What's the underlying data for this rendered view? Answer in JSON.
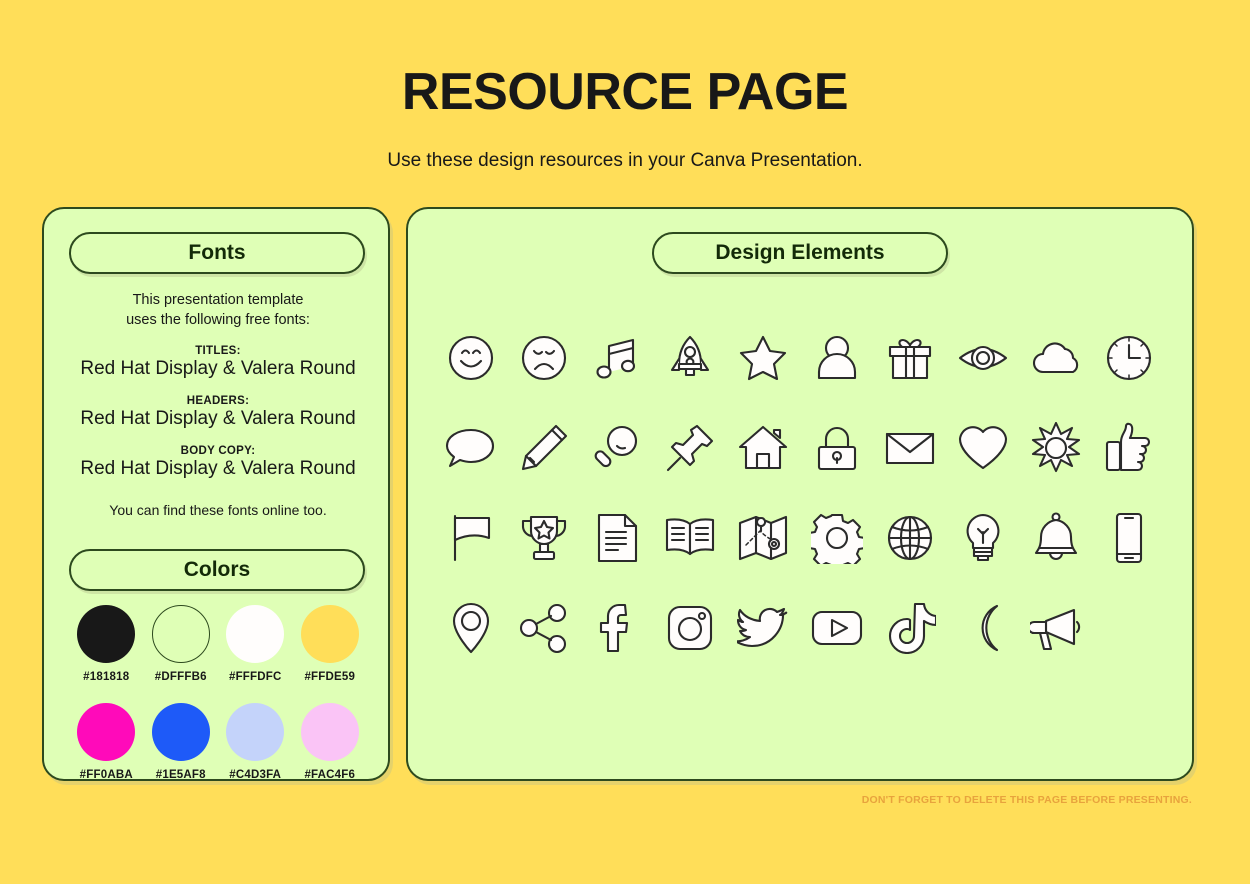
{
  "header": {
    "title": "RESOURCE PAGE",
    "subtitle": "Use these design resources in your Canva Presentation."
  },
  "fonts_panel": {
    "pill_label": "Fonts",
    "intro_line1": "This presentation template",
    "intro_line2": "uses the following free fonts:",
    "entries": [
      {
        "label": "TITLES:",
        "name": "Red Hat Display & Valera Round"
      },
      {
        "label": "HEADERS:",
        "name": "Red Hat Display & Valera Round"
      },
      {
        "label": "BODY COPY:",
        "name": "Red Hat Display & Valera Round"
      }
    ],
    "outro": "You can find these fonts online too."
  },
  "colors_panel": {
    "pill_label": "Colors",
    "swatches": [
      {
        "hex": "#181818",
        "outlined": false
      },
      {
        "hex": "#DFFFB6",
        "outlined": true
      },
      {
        "hex": "#FFFDFC",
        "outlined": false
      },
      {
        "hex": "#FFDE59",
        "outlined": false
      },
      {
        "hex": "#FF0ABA",
        "outlined": false
      },
      {
        "hex": "#1E5AF8",
        "outlined": false
      },
      {
        "hex": "#C4D3FA",
        "outlined": false
      },
      {
        "hex": "#FAC4F6",
        "outlined": false
      }
    ]
  },
  "elements_panel": {
    "pill_label": "Design Elements",
    "icons": [
      "smiley-face-icon",
      "sad-face-icon",
      "music-note-icon",
      "rocket-icon",
      "star-icon",
      "person-icon",
      "gift-icon",
      "eye-icon",
      "cloud-icon",
      "clock-icon",
      "speech-bubble-icon",
      "pencil-icon",
      "magnifying-glass-icon",
      "pushpin-icon",
      "house-icon",
      "lock-icon",
      "envelope-icon",
      "heart-icon",
      "sun-icon",
      "thumbs-up-icon",
      "flag-icon",
      "trophy-icon",
      "document-icon",
      "book-icon",
      "map-icon",
      "gear-icon",
      "globe-icon",
      "lightbulb-icon",
      "bell-icon",
      "phone-icon",
      "location-pin-icon",
      "share-icon",
      "facebook-icon",
      "instagram-icon",
      "twitter-icon",
      "youtube-icon",
      "tiktok-icon",
      "moon-icon",
      "megaphone-icon"
    ]
  },
  "footer": {
    "note": "DON'T FORGET TO DELETE THIS PAGE BEFORE PRESENTING."
  },
  "theme": {
    "background": "#FFDE59",
    "panel_background": "#DFFFB6",
    "panel_border": "#2d4a1e",
    "text": "#181818",
    "footer_text": "#E8A33D"
  }
}
